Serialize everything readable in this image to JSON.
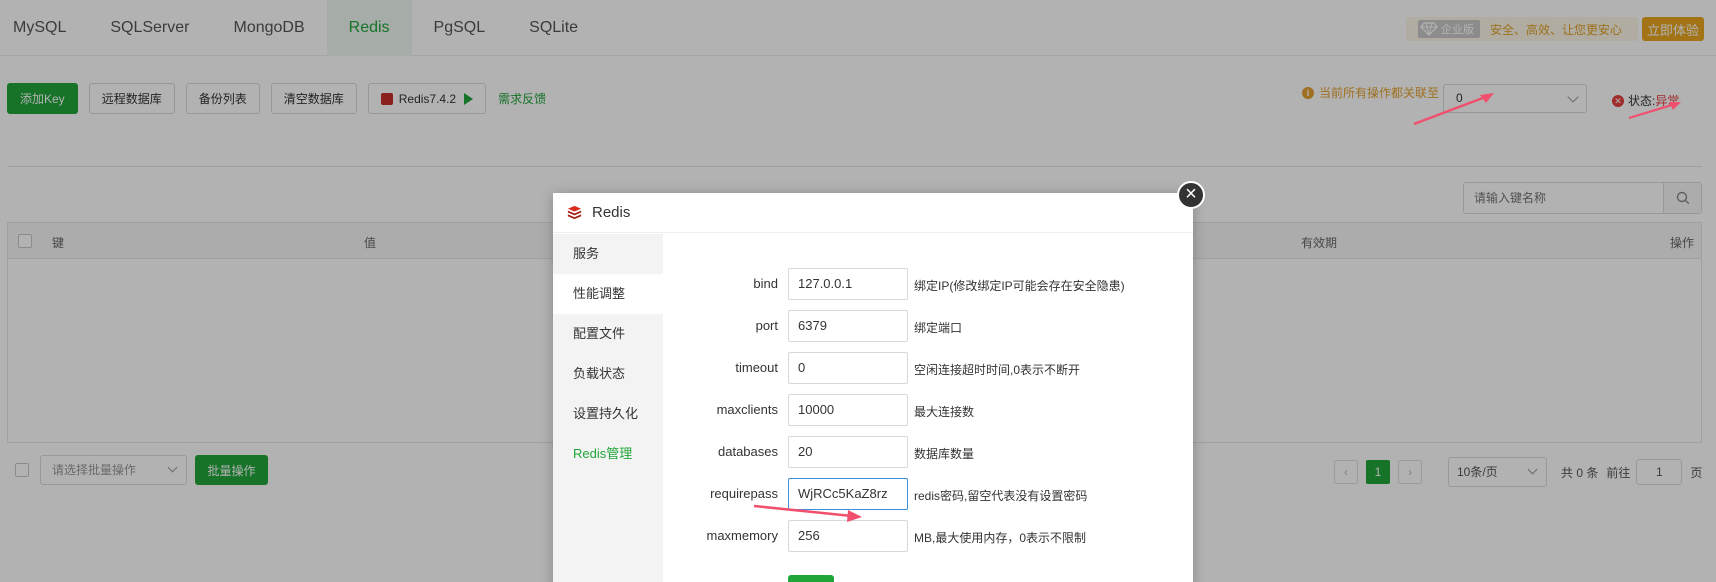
{
  "tabs": [
    "MySQL",
    "SQLServer",
    "MongoDB",
    "Redis",
    "PgSQL",
    "SQLite"
  ],
  "enterprise": {
    "badge": "企业版",
    "slogan": "安全、高效、让您更安心",
    "try_label": "立即体验"
  },
  "toolbar": {
    "add_key": "添加Key",
    "remote_db": "远程数据库",
    "backup_list": "备份列表",
    "clear_db": "清空数据库",
    "version": "Redis7.4.2",
    "feedback": "需求反馈"
  },
  "db_link": {
    "text": "当前所有操作都关联至",
    "selected": "0"
  },
  "status": {
    "label": "状态:",
    "value": "异常"
  },
  "search": {
    "placeholder": "请输入键名称"
  },
  "table": {
    "headers": [
      "键",
      "值",
      "有效期",
      "操作"
    ]
  },
  "footer": {
    "batch_placeholder": "请选择批量操作",
    "batch_button": "批量操作",
    "current_page": "1",
    "per_page": "10条/页",
    "total": "共 0 条",
    "goto_label": "前往",
    "goto_value": "1",
    "page_suffix": "页"
  },
  "modal": {
    "title": "Redis",
    "nav": [
      "服务",
      "性能调整",
      "配置文件",
      "负载状态",
      "设置持久化",
      "Redis管理"
    ],
    "fields": [
      {
        "label": "bind",
        "value": "127.0.0.1",
        "desc": "绑定IP(修改绑定IP可能会存在安全隐患)"
      },
      {
        "label": "port",
        "value": "6379",
        "desc": "绑定端口"
      },
      {
        "label": "timeout",
        "value": "0",
        "desc": "空闲连接超时时间,0表示不断开"
      },
      {
        "label": "maxclients",
        "value": "10000",
        "desc": "最大连接数"
      },
      {
        "label": "databases",
        "value": "20",
        "desc": "数据库数量"
      },
      {
        "label": "requirepass",
        "value": "WjRCc5KaZ8rz",
        "desc": "redis密码,留空代表没有设置密码"
      },
      {
        "label": "maxmemory",
        "value": "256",
        "desc": "MB,最大使用内存，0表示不限制"
      }
    ]
  },
  "colors": {
    "accent": "#20a53a",
    "warning": "#e3a12f",
    "danger": "#e53e3e",
    "annotation_arrow": "#f0506e"
  }
}
